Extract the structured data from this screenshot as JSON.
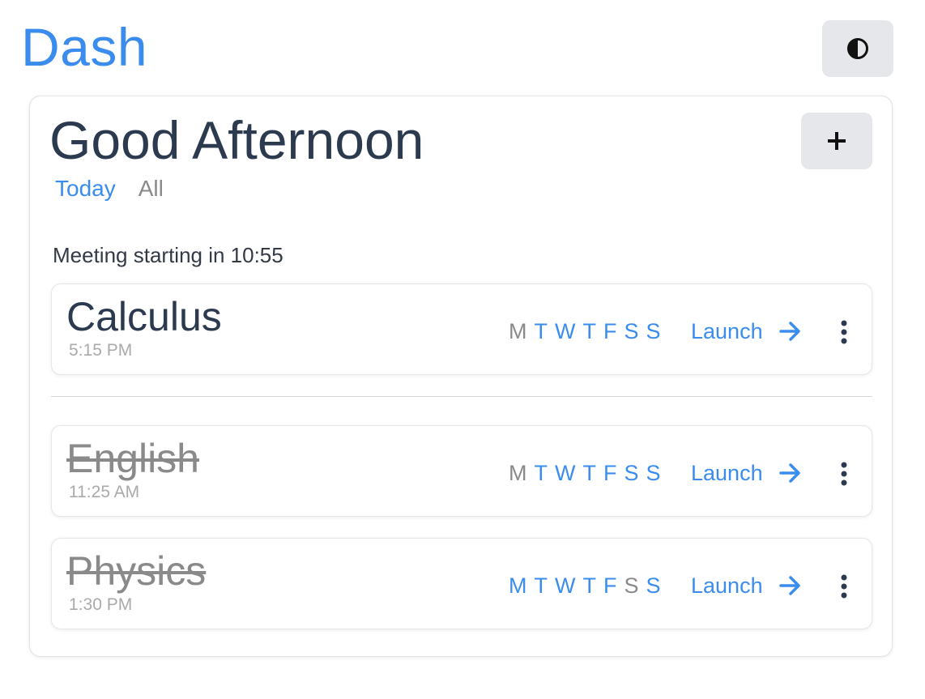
{
  "app": {
    "title": "Dash",
    "accent_color": "#3a8dee",
    "theme_icon": "contrast-icon"
  },
  "header": {
    "greeting": "Good Afternoon",
    "add_icon": "plus-icon"
  },
  "tabs": [
    {
      "label": "Today",
      "active": true
    },
    {
      "label": "All",
      "active": false
    }
  ],
  "status": {
    "text": "Meeting starting in 10:55"
  },
  "meetings": [
    {
      "name": "Calculus",
      "time": "5:15 PM",
      "completed": false,
      "days": [
        {
          "label": "M",
          "active": false
        },
        {
          "label": "T",
          "active": true
        },
        {
          "label": "W",
          "active": true
        },
        {
          "label": "T",
          "active": true
        },
        {
          "label": "F",
          "active": true
        },
        {
          "label": "S",
          "active": true
        },
        {
          "label": "S",
          "active": true
        }
      ],
      "launch_label": "Launch"
    },
    {
      "name": "English",
      "time": "11:25 AM",
      "completed": true,
      "days": [
        {
          "label": "M",
          "active": false
        },
        {
          "label": "T",
          "active": true
        },
        {
          "label": "W",
          "active": true
        },
        {
          "label": "T",
          "active": true
        },
        {
          "label": "F",
          "active": true
        },
        {
          "label": "S",
          "active": true
        },
        {
          "label": "S",
          "active": true
        }
      ],
      "launch_label": "Launch"
    },
    {
      "name": "Physics",
      "time": "1:30 PM",
      "completed": true,
      "days": [
        {
          "label": "M",
          "active": true
        },
        {
          "label": "T",
          "active": true
        },
        {
          "label": "W",
          "active": true
        },
        {
          "label": "T",
          "active": true
        },
        {
          "label": "F",
          "active": true
        },
        {
          "label": "S",
          "active": false
        },
        {
          "label": "S",
          "active": true
        }
      ],
      "launch_label": "Launch"
    }
  ]
}
